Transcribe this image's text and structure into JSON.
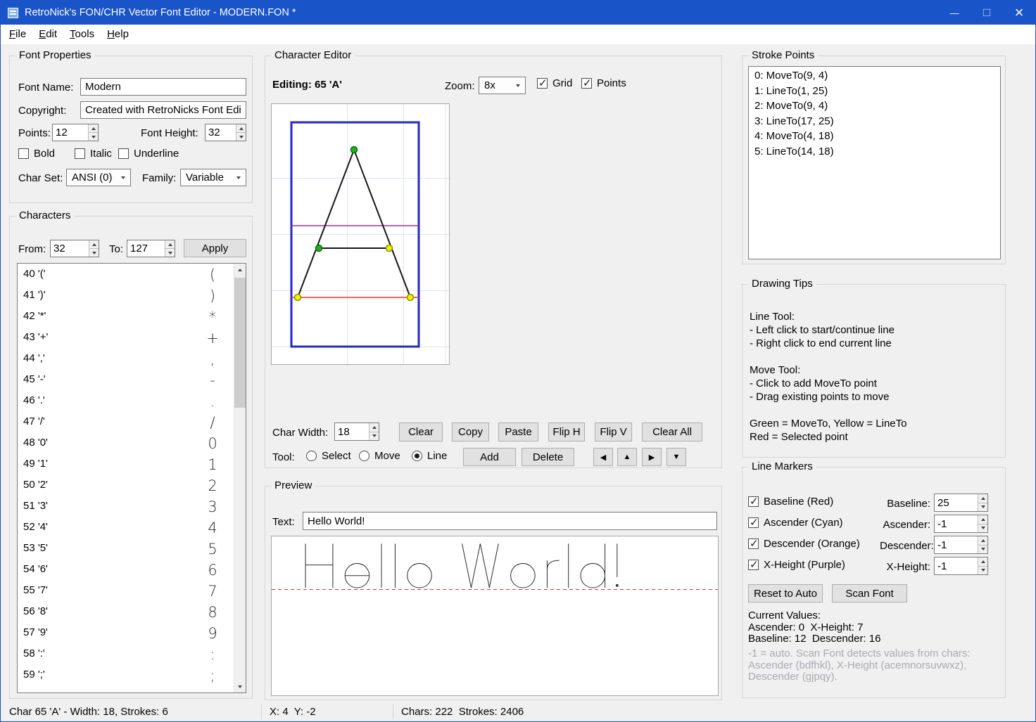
{
  "window": {
    "title": "RetroNick's FON/CHR Vector Font Editor - MODERN.FON *"
  },
  "menu": {
    "items": [
      "File",
      "Edit",
      "Tools",
      "Help"
    ]
  },
  "font_properties": {
    "title": "Font Properties",
    "font_name_label": "Font Name:",
    "font_name_value": "Modern",
    "copyright_label": "Copyright:",
    "copyright_value": "Created with RetroNicks Font Editor",
    "points_label": "Points:",
    "points_value": "12",
    "font_height_label": "Font Height:",
    "font_height_value": "32",
    "bold_label": "Bold",
    "italic_label": "Italic",
    "underline_label": "Underline",
    "char_set_label": "Char Set:",
    "char_set_value": "ANSI (0)",
    "family_label": "Family:",
    "family_value": "Variable"
  },
  "characters": {
    "title": "Characters",
    "from_label": "From:",
    "from_value": "32",
    "to_label": "To:",
    "to_value": "127",
    "apply_label": "Apply",
    "items": [
      {
        "label": "40 '('",
        "glyph": "("
      },
      {
        "label": "41 ')'",
        "glyph": ")"
      },
      {
        "label": "42 '*'",
        "glyph": "*"
      },
      {
        "label": "43 '+'",
        "glyph": "+"
      },
      {
        "label": "44 ','",
        "glyph": ","
      },
      {
        "label": "45 '-'",
        "glyph": "-"
      },
      {
        "label": "46 '.'",
        "glyph": "."
      },
      {
        "label": "47 '/'",
        "glyph": "/"
      },
      {
        "label": "48 '0'",
        "glyph": "0"
      },
      {
        "label": "49 '1'",
        "glyph": "1"
      },
      {
        "label": "50 '2'",
        "glyph": "2"
      },
      {
        "label": "51 '3'",
        "glyph": "3"
      },
      {
        "label": "52 '4'",
        "glyph": "4"
      },
      {
        "label": "53 '5'",
        "glyph": "5"
      },
      {
        "label": "54 '6'",
        "glyph": "6"
      },
      {
        "label": "55 '7'",
        "glyph": "7"
      },
      {
        "label": "56 '8'",
        "glyph": "8"
      },
      {
        "label": "57 '9'",
        "glyph": "9"
      },
      {
        "label": "58 ':'",
        "glyph": ":"
      },
      {
        "label": "59 ';'",
        "glyph": ";"
      }
    ]
  },
  "character_editor": {
    "title": "Character Editor",
    "editing_label": "Editing: 65 'A'",
    "zoom_label": "Zoom:",
    "zoom_value": "8x",
    "grid_label": "Grid",
    "points_label": "Points",
    "char_width_label": "Char Width:",
    "char_width_value": "18",
    "clear_label": "Clear",
    "copy_label": "Copy",
    "paste_label": "Paste",
    "flip_h_label": "Flip H",
    "flip_v_label": "Flip V",
    "clear_all_label": "Clear All",
    "tool_label": "Tool:",
    "tool_select_label": "Select",
    "tool_move_label": "Move",
    "tool_line_label": "Line",
    "add_label": "Add",
    "delete_label": "Delete",
    "nudge_left": "◀",
    "nudge_up": "▲",
    "nudge_right": "▶",
    "nudge_down": "▼"
  },
  "preview": {
    "title": "Preview",
    "text_label": "Text:",
    "text_value": "Hello World!"
  },
  "stroke_points": {
    "title": "Stroke Points",
    "items": [
      "0: MoveTo(9, 4)",
      "1: LineTo(1, 25)",
      "2: MoveTo(9, 4)",
      "3: LineTo(17, 25)",
      "4: MoveTo(4, 18)",
      "5: LineTo(14, 18)"
    ]
  },
  "drawing_tips": {
    "title": "Drawing Tips",
    "lines": [
      "Line Tool:",
      "- Left click to start/continue line",
      "- Right click to end current line",
      "",
      "Move Tool:",
      "- Click to add MoveTo point",
      "- Drag existing points to move",
      "",
      "Green = MoveTo, Yellow = LineTo",
      "Red = Selected point"
    ]
  },
  "line_markers": {
    "title": "Line Markers",
    "baseline_check_label": "Baseline (Red)",
    "ascender_check_label": "Ascender (Cyan)",
    "descender_check_label": "Descender (Orange)",
    "xheight_check_label": "X-Height (Purple)",
    "baseline_label": "Baseline:",
    "baseline_value": "25",
    "ascender_label": "Ascender:",
    "ascender_value": "-1",
    "descender_label": "Descender:",
    "descender_value": "-1",
    "xheight_label": "X-Height:",
    "xheight_value": "-1",
    "reset_label": "Reset to Auto",
    "scan_label": "Scan Font",
    "current_values_title": "Current Values:",
    "current_line1": "Ascender: 0  X-Height: 7",
    "current_line2": "Baseline: 12  Descender: 16",
    "hint": "-1 = auto. Scan Font detects values from chars: Ascender (bdfhkl), X-Height (acemnorsuvwxz), Descender (gjpqy)."
  },
  "status_bar": {
    "left": "Char 65 'A' - Width: 18, Strokes: 6",
    "middle": "X: 4  Y: -2",
    "right": "Chars: 222  Strokes: 2406"
  },
  "colors": {
    "titlebar": "#1a54c9",
    "moveto_point": "#1db31d",
    "lineto_point": "#f0f000",
    "baseline_marker": "#e03030",
    "xheight_marker": "#993399",
    "cell_border": "#2626cc"
  }
}
